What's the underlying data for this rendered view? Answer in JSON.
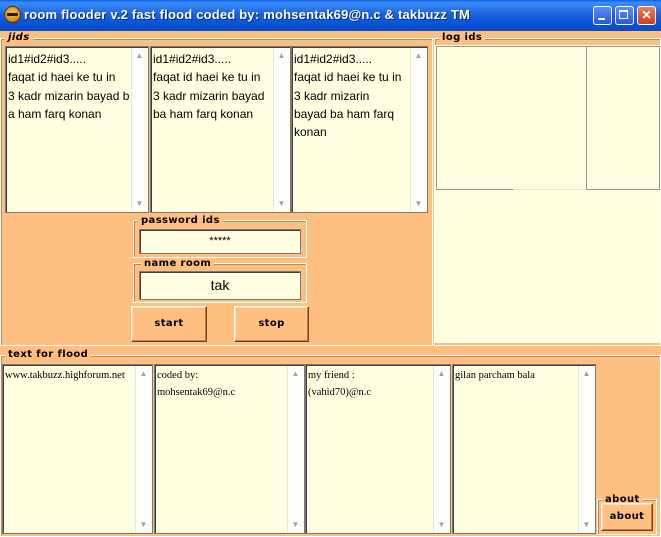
{
  "window": {
    "title": "room flooder v.2  fast flood coded by: mohsentak69@n.c & takbuzz TM",
    "icon": "smiley-bee-icon",
    "controls": [
      "minimize-icon",
      "maximize-icon",
      "close-icon"
    ],
    "colors": {
      "background": "#ffbf80",
      "field": "#ffffe1",
      "titlebar": "#0552d4"
    }
  },
  "jids": {
    "label": "jids",
    "memos": [
      {
        "text": "id1#id2#id3.....\nfaqat id haei ke tu in\n3 kadr mizarin bayad ba ham farq konan"
      },
      {
        "text": "id1#id2#id3.....\nfaqat id haei ke tu in\n3 kadr mizarin bayad ba ham farq konan"
      },
      {
        "text": "id1#id2#id3.....\nfaqat id haei ke tu in\n3 kadr mizarin\nbayad ba ham farq\nkonan"
      }
    ]
  },
  "password": {
    "label": "password ids",
    "value": "*****"
  },
  "room": {
    "label": "name room",
    "value": "tak"
  },
  "buttons": {
    "start": "start",
    "stop": "stop",
    "about": "about"
  },
  "log": {
    "label": "log ids"
  },
  "flood": {
    "label": "text for flood",
    "memos": [
      {
        "text": "www.takbuzz.highforum.net"
      },
      {
        "text": "coded by:\nmohsentak69@n.c"
      },
      {
        "text": "my friend :\n(vahid70)@n.c"
      },
      {
        "text": "gilan parcham bala"
      }
    ]
  },
  "about": {
    "label": "about"
  }
}
